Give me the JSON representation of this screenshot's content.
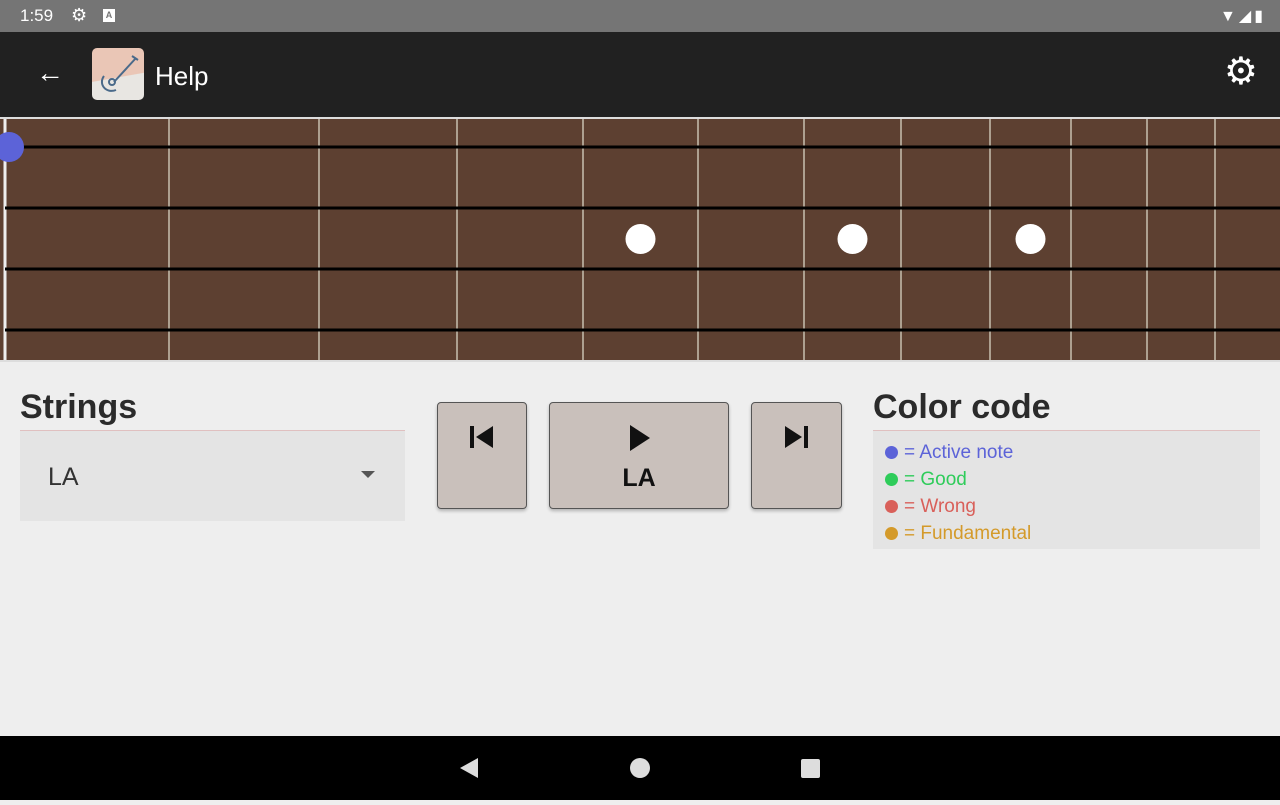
{
  "status_bar": {
    "time": "1:59"
  },
  "app_bar": {
    "title": "Help"
  },
  "fretboard": {
    "fret_count": 11,
    "string_count": 4,
    "inlay_frets": [
      5,
      7,
      9
    ],
    "active_note": {
      "string": 1,
      "fret": 0,
      "color": "#5c63d8"
    }
  },
  "strings_panel": {
    "heading": "Strings",
    "selected": "LA"
  },
  "player": {
    "note": "LA"
  },
  "color_code": {
    "heading": "Color code",
    "items": [
      {
        "label": "= Active note",
        "color": "#5c63d8"
      },
      {
        "label": "= Good",
        "color": "#2ecc5a"
      },
      {
        "label": "= Wrong",
        "color": "#d9605a"
      },
      {
        "label": "= Fundamental",
        "color": "#d49a2a"
      }
    ]
  }
}
